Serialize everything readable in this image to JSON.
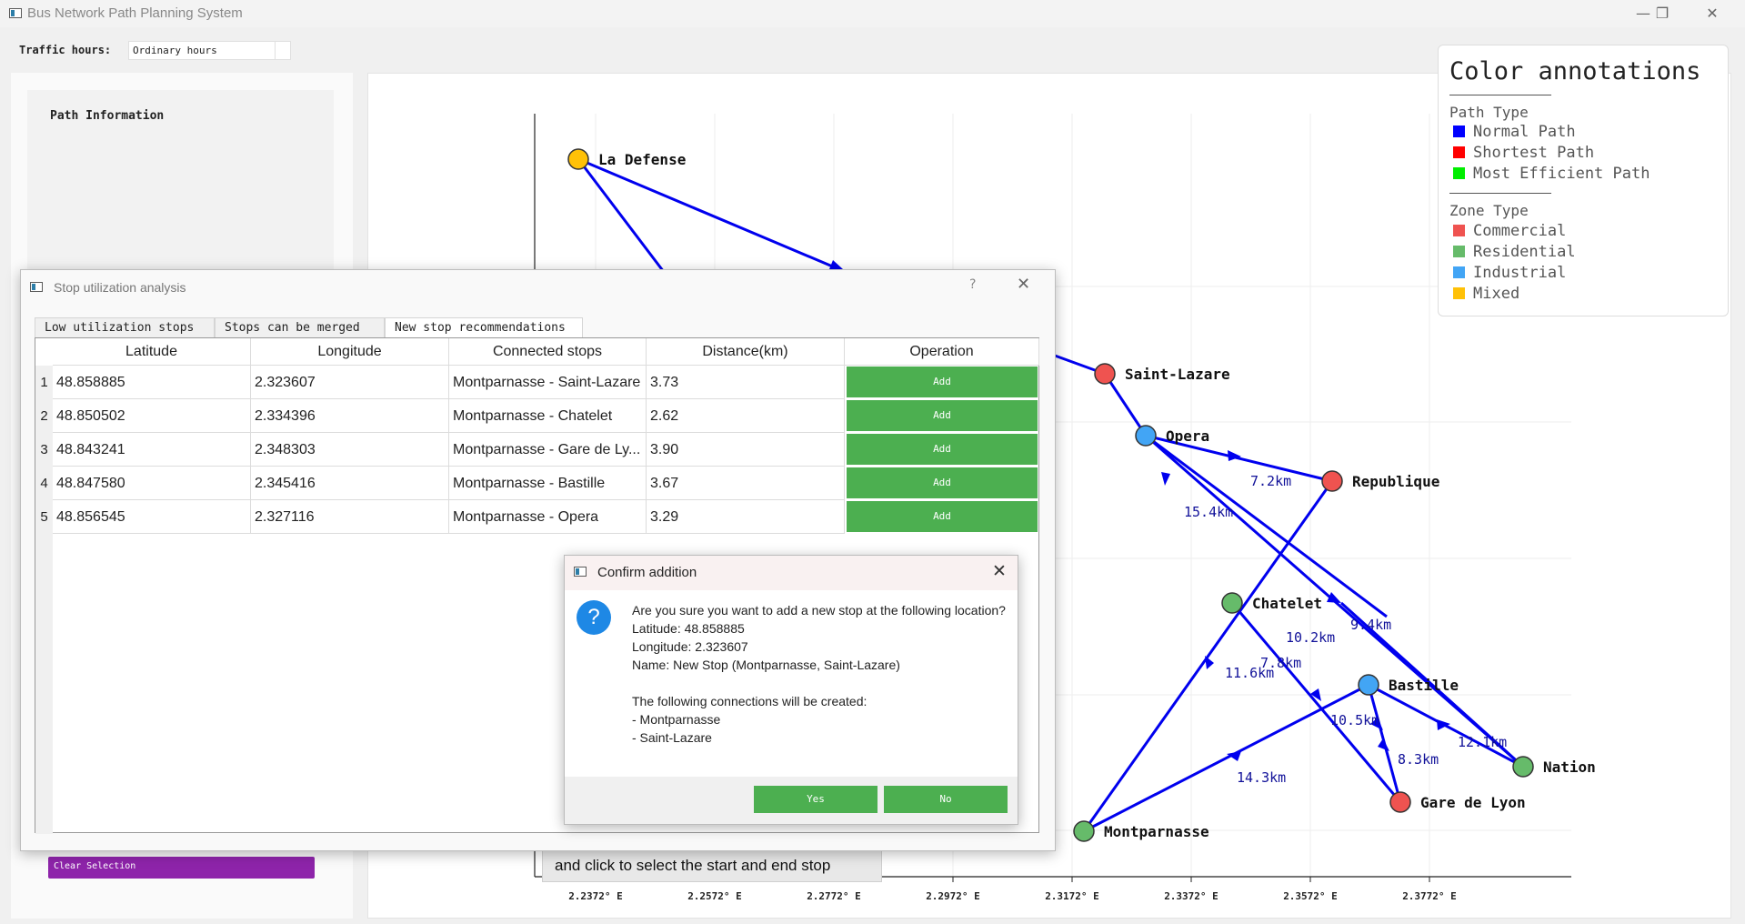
{
  "window": {
    "title": "Bus Network Path Planning System",
    "minimize": "—",
    "restore": "❐",
    "close": "✕"
  },
  "toolbar": {
    "traffic_label": "Traffic hours:",
    "traffic_value": "Ordinary hours"
  },
  "left_panel": {
    "path_info_title": "Path Information",
    "clear_button": "Clear Selection"
  },
  "map": {
    "hint": "and click to select the start and end stop",
    "x_ticks": [
      "2.2372° E",
      "2.2572° E",
      "2.2772° E",
      "2.2972° E",
      "2.3172° E",
      "2.3372° E",
      "2.3572° E",
      "2.3772° E"
    ],
    "stops": [
      {
        "name": "La Defense",
        "zone": "Mixed"
      },
      {
        "name": "Saint-Lazare",
        "zone": "Commercial"
      },
      {
        "name": "Opera",
        "zone": "Industrial"
      },
      {
        "name": "Republique",
        "zone": "Commercial"
      },
      {
        "name": "Chatelet",
        "zone": "Residential"
      },
      {
        "name": "Bastille",
        "zone": "Industrial"
      },
      {
        "name": "Nation",
        "zone": "Residential"
      },
      {
        "name": "Gare de Lyon",
        "zone": "Commercial"
      },
      {
        "name": "Montparnasse",
        "zone": "Residential"
      }
    ],
    "edge_labels": [
      "7.2km",
      "15.4km",
      "9.4km",
      "10.2km",
      "7.8km",
      "11.6km",
      "10.5km",
      "12.1km",
      "8.3km",
      "14.3km"
    ]
  },
  "legend": {
    "title": "Color annotations",
    "path_section": "Path Type",
    "path_items": [
      {
        "label": "Normal Path",
        "color": "#0000ff"
      },
      {
        "label": "Shortest Path",
        "color": "#ff0000"
      },
      {
        "label": "Most Efficient Path",
        "color": "#00ee00"
      }
    ],
    "zone_section": "Zone Type",
    "zone_items": [
      {
        "label": "Commercial",
        "color": "#ef5350"
      },
      {
        "label": "Residential",
        "color": "#66bb6a"
      },
      {
        "label": "Industrial",
        "color": "#42a5f5"
      },
      {
        "label": "Mixed",
        "color": "#ffc107"
      }
    ]
  },
  "analysis_dialog": {
    "title": "Stop utilization analysis",
    "help": "?",
    "close": "✕",
    "tabs": [
      "Low utilization stops",
      "Stops can be merged",
      "New stop recommendations"
    ],
    "columns": [
      "Latitude",
      "Longitude",
      "Connected stops",
      "Distance(km)",
      "Operation"
    ],
    "rows": [
      {
        "num": "1",
        "lat": "48.858885",
        "lon": "2.323607",
        "stops": "Montparnasse - Saint-Lazare",
        "dist": "3.73",
        "op": "Add"
      },
      {
        "num": "2",
        "lat": "48.850502",
        "lon": "2.334396",
        "stops": "Montparnasse - Chatelet",
        "dist": "2.62",
        "op": "Add"
      },
      {
        "num": "3",
        "lat": "48.843241",
        "lon": "2.348303",
        "stops": "Montparnasse - Gare de Ly...",
        "dist": "3.90",
        "op": "Add"
      },
      {
        "num": "4",
        "lat": "48.847580",
        "lon": "2.345416",
        "stops": "Montparnasse - Bastille",
        "dist": "3.67",
        "op": "Add"
      },
      {
        "num": "5",
        "lat": "48.856545",
        "lon": "2.327116",
        "stops": "Montparnasse - Opera",
        "dist": "3.29",
        "op": "Add"
      }
    ]
  },
  "confirm_dialog": {
    "title": "Confirm addition",
    "close": "✕",
    "icon": "?",
    "lines": [
      "Are you sure you want to add a new stop at the following location?",
      "Latitude: 48.858885",
      "Longitude: 2.323607",
      "Name: New Stop (Montparnasse, Saint-Lazare)",
      "",
      "The following connections will be created:",
      "- Montparnasse",
      "- Saint-Lazare"
    ],
    "yes": "Yes",
    "no": "No"
  }
}
